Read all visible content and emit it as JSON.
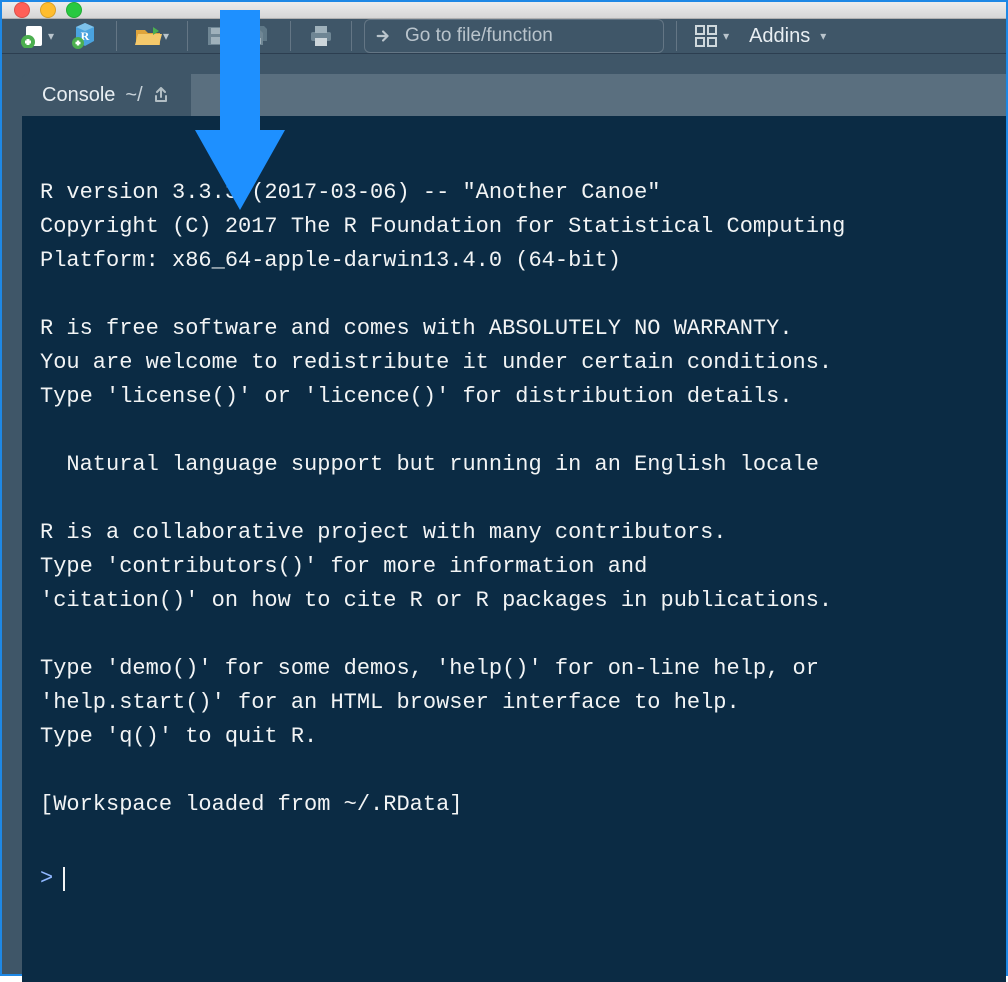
{
  "window": {
    "platform": "mac"
  },
  "toolbar": {
    "goto_placeholder": "Go to file/function",
    "addins_label": "Addins"
  },
  "console": {
    "tab_label": "Console",
    "working_dir": "~/",
    "prompt": ">",
    "lines": [
      "R version 3.3.3 (2017-03-06) -- \"Another Canoe\"",
      "Copyright (C) 2017 The R Foundation for Statistical Computing",
      "Platform: x86_64-apple-darwin13.4.0 (64-bit)",
      "",
      "R is free software and comes with ABSOLUTELY NO WARRANTY.",
      "You are welcome to redistribute it under certain conditions.",
      "Type 'license()' or 'licence()' for distribution details.",
      "",
      "  Natural language support but running in an English locale",
      "",
      "R is a collaborative project with many contributors.",
      "Type 'contributors()' for more information and",
      "'citation()' on how to cite R or R packages in publications.",
      "",
      "Type 'demo()' for some demos, 'help()' for on-line help, or",
      "'help.start()' for an HTML browser interface to help.",
      "Type 'q()' to quit R.",
      "",
      "[Workspace loaded from ~/.RData]",
      ""
    ]
  }
}
